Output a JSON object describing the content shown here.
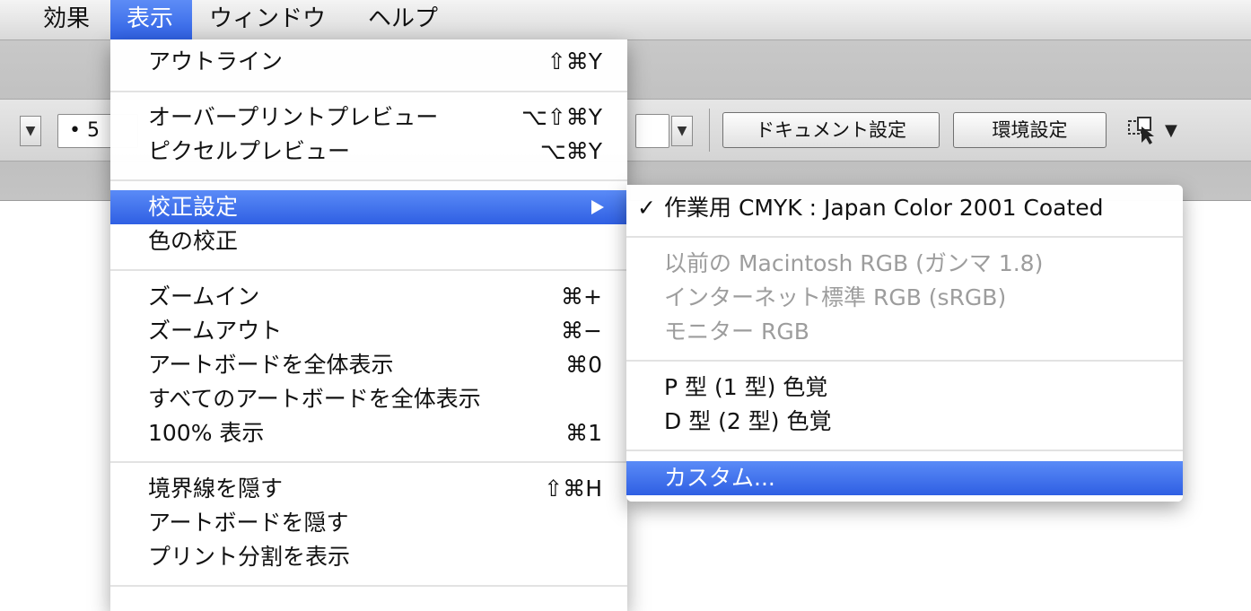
{
  "menubar": {
    "items": [
      {
        "label": "効果"
      },
      {
        "label": "表示"
      },
      {
        "label": "ウィンドウ"
      },
      {
        "label": "ヘルプ"
      }
    ]
  },
  "toolbar": {
    "stroke_value": "• 5",
    "document_setup_label": "ドキュメント設定",
    "preferences_label": "環境設定",
    "dropdown_arrow": "▼"
  },
  "view_menu": {
    "items": [
      {
        "label": "アウトライン",
        "shortcut": "⇧⌘Y"
      },
      {
        "label": "オーバープリントプレビュー",
        "shortcut": "⌥⇧⌘Y"
      },
      {
        "label": "ピクセルプレビュー",
        "shortcut": "⌥⌘Y"
      },
      {
        "label": "校正設定",
        "shortcut": ""
      },
      {
        "label": "色の校正",
        "shortcut": ""
      },
      {
        "label": "ズームイン",
        "shortcut": "⌘+"
      },
      {
        "label": "ズームアウト",
        "shortcut": "⌘−"
      },
      {
        "label": "アートボードを全体表示",
        "shortcut": "⌘0"
      },
      {
        "label": "すべてのアートボードを全体表示",
        "shortcut": ""
      },
      {
        "label": "100% 表示",
        "shortcut": "⌘1"
      },
      {
        "label": "境界線を隠す",
        "shortcut": "⇧⌘H"
      },
      {
        "label": "アートボードを隠す",
        "shortcut": ""
      },
      {
        "label": "プリント分割を表示",
        "shortcut": ""
      }
    ]
  },
  "proof_submenu": {
    "checkmark": "✓",
    "items": [
      {
        "label": "作業用 CMYK : Japan Color 2001 Coated"
      },
      {
        "label": "以前の Macintosh RGB (ガンマ 1.8)"
      },
      {
        "label": "インターネット標準 RGB (sRGB)"
      },
      {
        "label": "モニター RGB"
      },
      {
        "label": "P 型 (1 型) 色覚"
      },
      {
        "label": "D 型 (2 型) 色覚"
      },
      {
        "label": "カスタム..."
      }
    ]
  },
  "colors": {
    "highlight": "#3a6ce8",
    "disabled_text": "#9d9d9d"
  }
}
